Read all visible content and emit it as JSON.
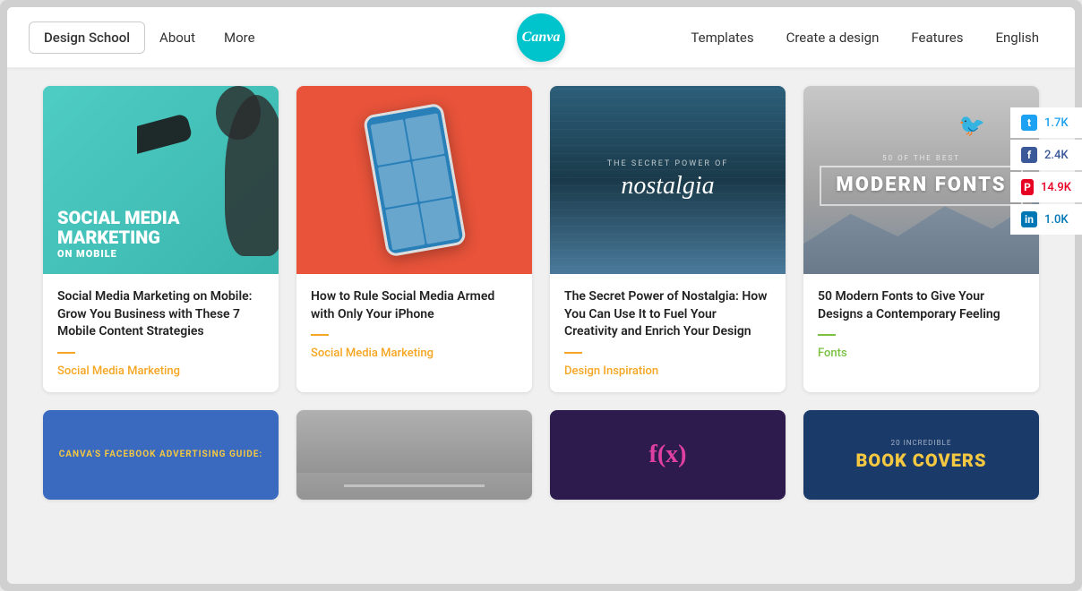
{
  "header": {
    "brand": "Design School",
    "nav_items": [
      "About",
      "More"
    ],
    "logo_text": "Canva",
    "right_nav": [
      "Templates",
      "Create a design",
      "Features",
      "English"
    ]
  },
  "social": {
    "items": [
      {
        "platform": "twitter",
        "count": "1.7K",
        "icon": "t"
      },
      {
        "platform": "facebook",
        "count": "2.4K",
        "icon": "f"
      },
      {
        "platform": "pinterest",
        "count": "14.9K",
        "icon": "P"
      },
      {
        "platform": "linkedin",
        "count": "1.0K",
        "icon": "in"
      }
    ]
  },
  "cards_row1": [
    {
      "image_type": "social-media-img",
      "title": "Social Media Marketing on Mobile: Grow You Business with These 7 Mobile Content Strategies",
      "category": "Social Media Marketing",
      "category_color": "#f5a623"
    },
    {
      "image_type": "iphone-img",
      "title": "How to Rule Social Media Armed with Only Your iPhone",
      "category": "Social Media Marketing",
      "category_color": "#f5a623"
    },
    {
      "image_type": "nostalgia-img",
      "title": "The Secret Power of Nostalgia: How You Can Use It to Fuel Your Creativity and Enrich Your Design",
      "category": "Design Inspiration",
      "category_color": "#f5a623"
    },
    {
      "image_type": "fonts-img",
      "title": "50 Modern Fonts to Give Your Designs a Contemporary Feeling",
      "category": "Fonts",
      "category_color": "#7ac142"
    }
  ],
  "bottom_cards": [
    {
      "type": "facebook-ad",
      "text": "CANVA'S FACEBOOK ADVERTISING GUIDE:"
    },
    {
      "type": "road",
      "text": ""
    },
    {
      "type": "purple-design",
      "text": ""
    },
    {
      "type": "book-covers",
      "small": "20 INCREDIBLE",
      "big": "BOOK COVERS"
    }
  ],
  "card_img_labels": {
    "social_main": "SOCIAL MEDIA",
    "social_sub1": "MARKETING",
    "social_sub2": "ON MOBILE",
    "nostalgia_small": "THE SECRET POWER OF",
    "nostalgia_big": "nostalgia",
    "fonts_small": "50 OF THE BEST",
    "fonts_big": "MODERN FONTS"
  }
}
